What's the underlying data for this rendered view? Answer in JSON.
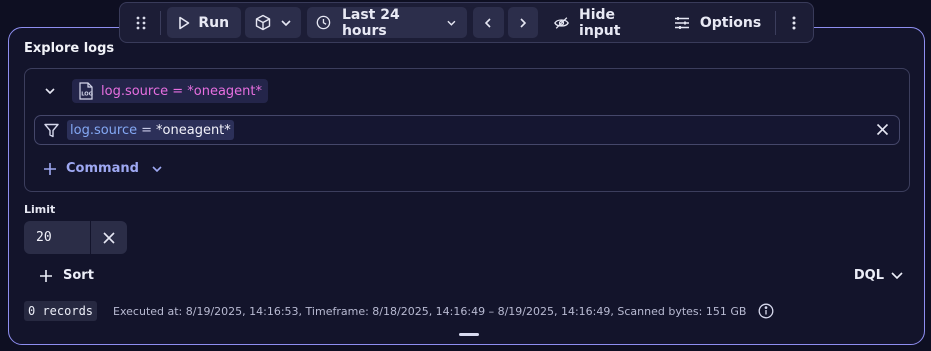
{
  "toolbar": {
    "run_label": "Run",
    "timeframe_label": "Last 24 hours",
    "hide_input_label": "Hide input",
    "options_label": "Options",
    "icons": [
      "drag-handle-icon",
      "play-icon",
      "cube-icon",
      "chevron-down-icon",
      "clock-icon",
      "chevron-left-icon",
      "chevron-right-icon",
      "eye-off-icon",
      "sliders-icon",
      "more-vertical-icon"
    ]
  },
  "section": {
    "title": "Explore logs"
  },
  "query": {
    "source_chip": "log.source = *oneagent*",
    "filter": {
      "key": "log.source",
      "operator": "=",
      "value": "*oneagent*"
    },
    "add_command_label": "Command"
  },
  "limit": {
    "label": "Limit",
    "value": "20"
  },
  "sort": {
    "label": "Sort"
  },
  "mode": {
    "label": "DQL"
  },
  "status": {
    "records": "0 records",
    "executed_text": "Executed at: 8/19/2025, 14:16:53, Timeframe: 8/18/2025, 14:16:49 – 8/19/2025, 14:16:49, Scanned bytes: 151 GB"
  },
  "colors": {
    "accent_border": "#8e8ef0",
    "chip_text": "#e76fe0",
    "command_text": "#9ea8f2",
    "background": "#0e0f22"
  }
}
